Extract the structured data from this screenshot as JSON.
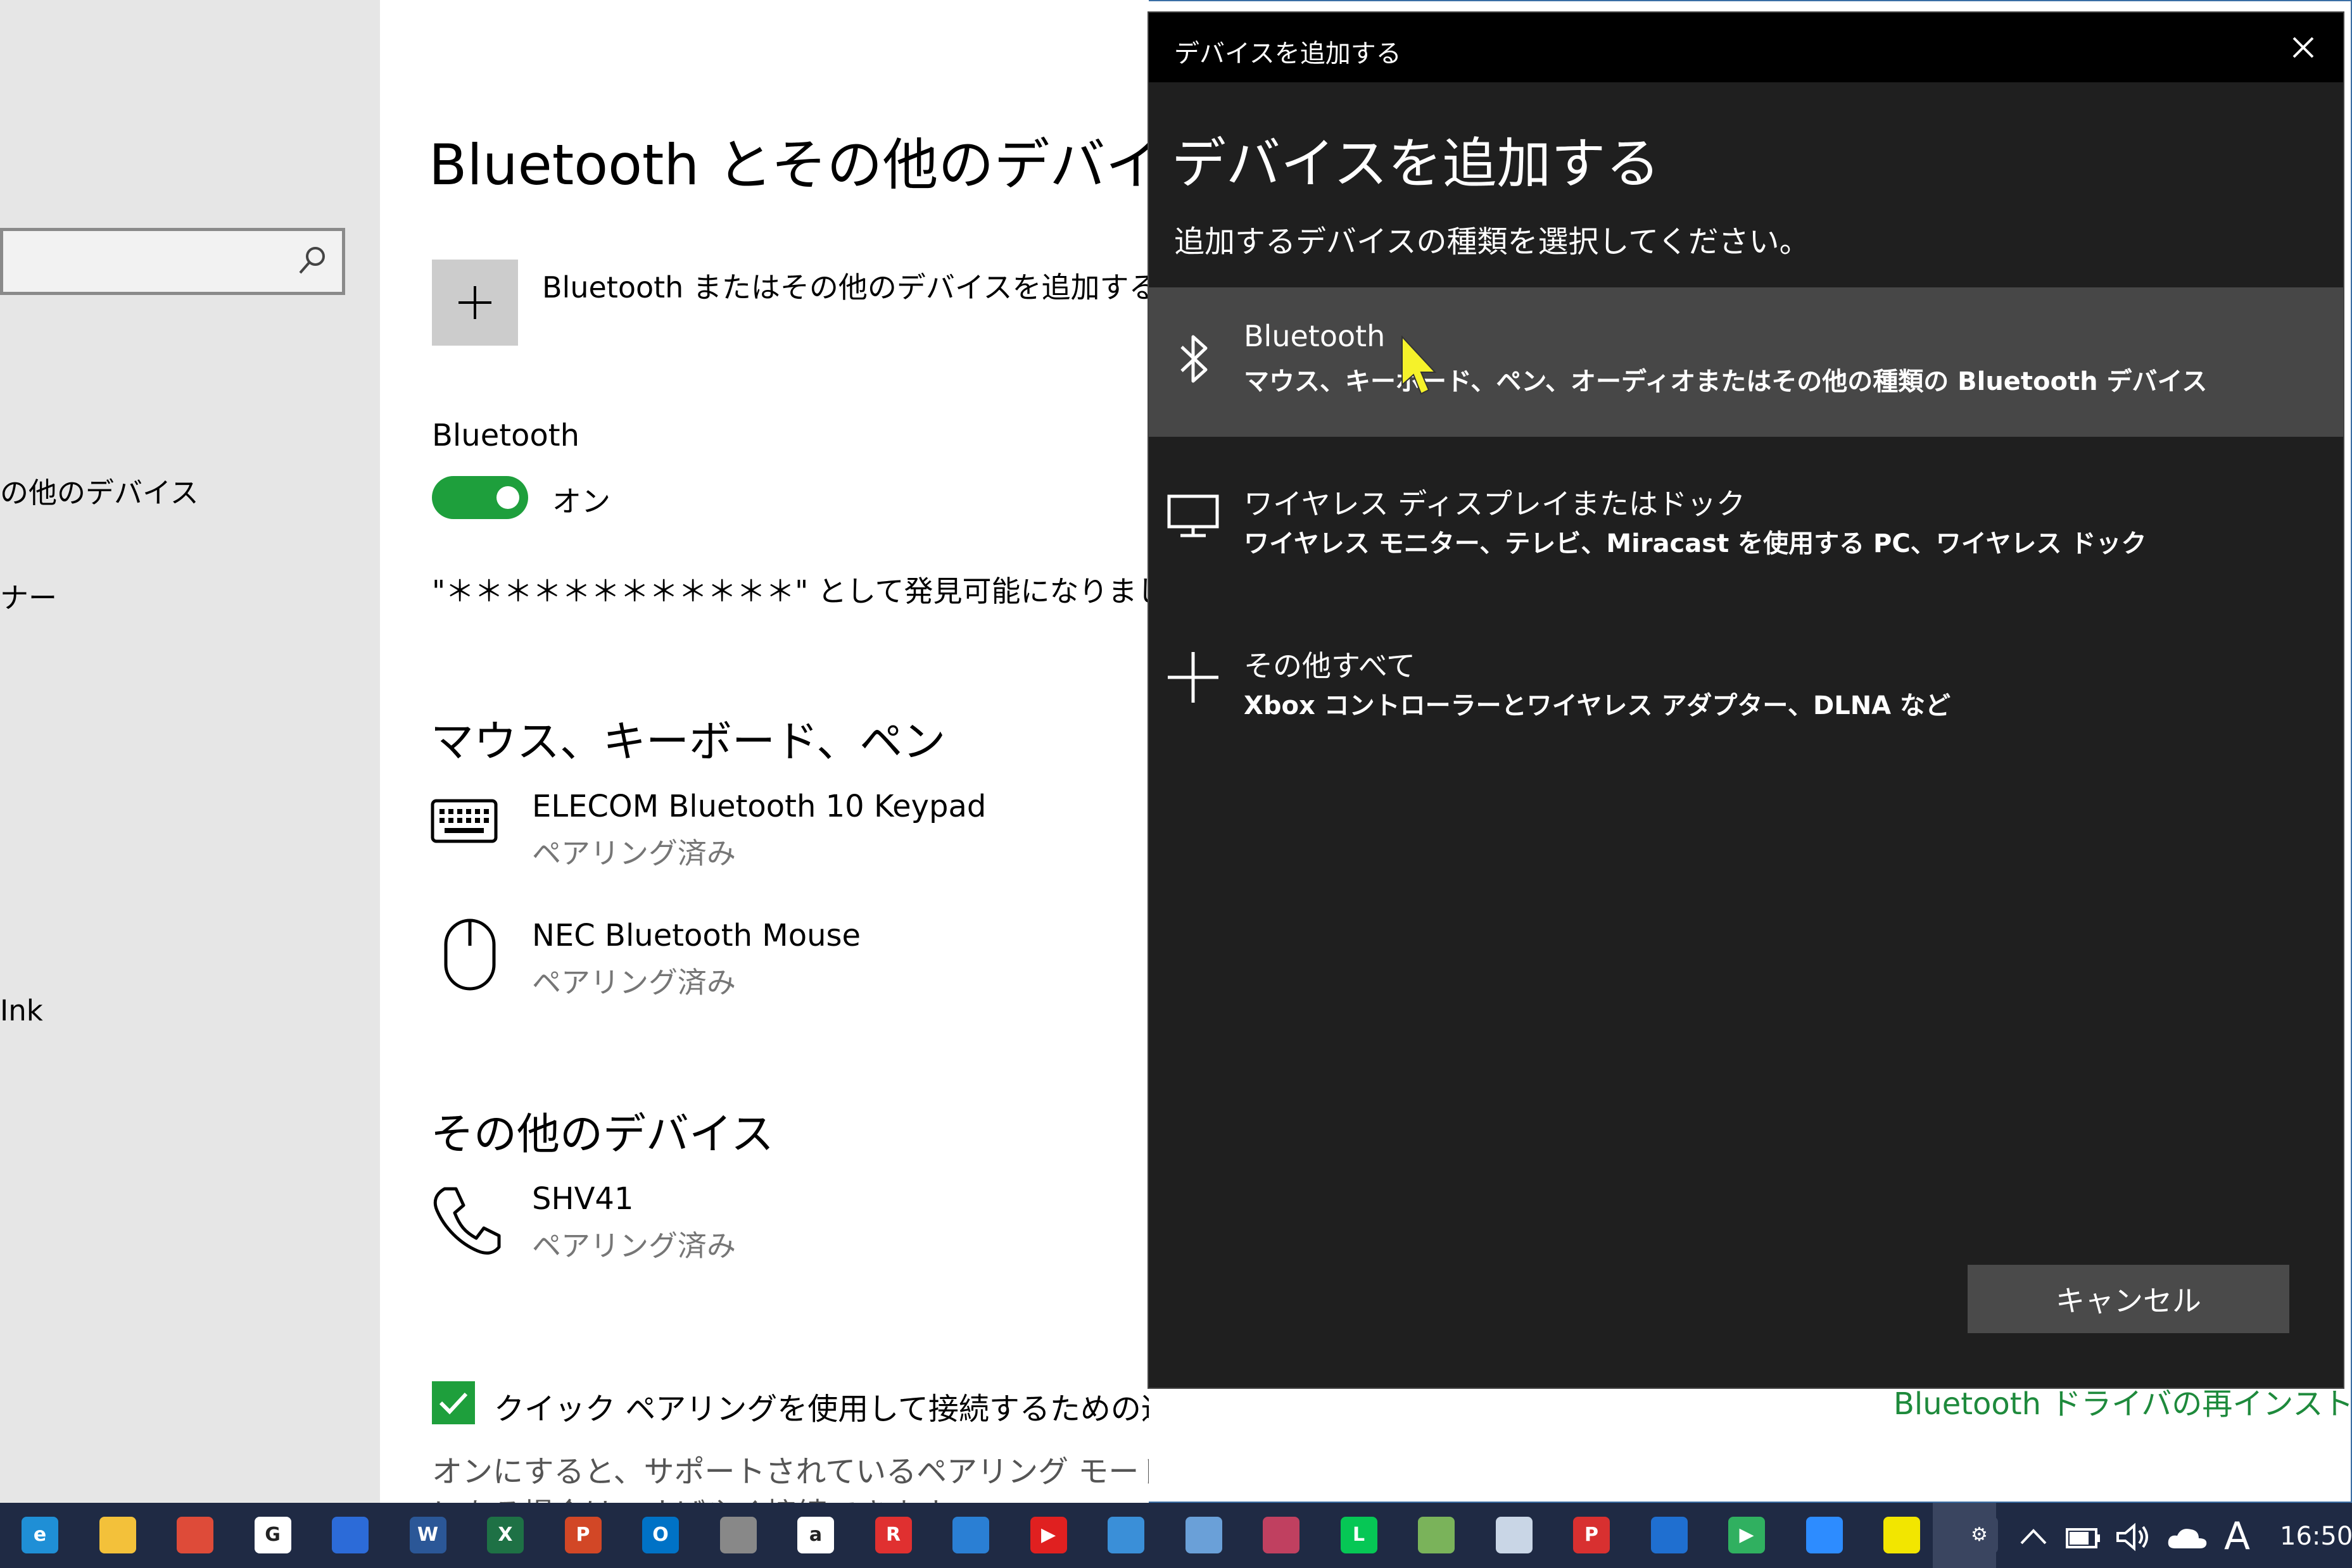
{
  "nav": {
    "items": [
      "の他のデバイス",
      "ナー",
      " Ink"
    ]
  },
  "main": {
    "title": "Bluetooth とその他のデバイス",
    "add_device": "Bluetooth またはその他のデバイスを追加する",
    "bluetooth_label": "Bluetooth",
    "toggle_state": "オン",
    "discoverable": "\"＊＊＊＊＊＊＊＊＊＊＊＊\" として発見可能になりました",
    "section_mouse": "マウス、キーボード、ペン",
    "devices": [
      {
        "name": "ELECOM Bluetooth 10 Keypad",
        "status": "ペアリング済み",
        "icon": "keyboard-icon"
      },
      {
        "name": "NEC Bluetooth Mouse",
        "status": "ペアリング済み",
        "icon": "mouse-icon"
      }
    ],
    "section_other": "その他のデバイス",
    "other_devices": [
      {
        "name": "SHV41",
        "status": "ペアリング済み",
        "icon": "phone-icon"
      }
    ],
    "swift_pair_label": "クイック ペアリングを使用して接続するための通知を表示する",
    "swift_pair_desc1": "オンにすると、サポートされているペアリング モードの Bluetooth デバイスが近く",
    "swift_pair_desc2": "にある場合は、すばやく接続できます。",
    "right_link": "Bluetooth ドライバの再インストール"
  },
  "dialog": {
    "titlebar": "デバイスを追加する",
    "heading": "デバイスを追加する",
    "subtitle": "追加するデバイスの種類を選択してください。",
    "options": [
      {
        "title": "Bluetooth",
        "desc": "マウス、キーボード、ペン、オーディオまたはその他の種類の Bluetooth デバイス",
        "icon": "bluetooth-icon"
      },
      {
        "title": "ワイヤレス ディスプレイまたはドック",
        "desc": "ワイヤレス モニター、テレビ、Miracast を使用する PC、ワイヤレス ドック",
        "icon": "monitor-icon"
      },
      {
        "title": "その他すべて",
        "desc": "Xbox コントローラーとワイヤレス アダプター、DLNA など",
        "icon": "plus-icon"
      }
    ],
    "cancel": "キャンセル"
  },
  "taskbar": {
    "apps": [
      {
        "name": "edge-icon",
        "color": "#1f8fd6",
        "glyph": "e"
      },
      {
        "name": "file-explorer-icon",
        "color": "#f3c13a",
        "glyph": ""
      },
      {
        "name": "chrome-icon",
        "color": "#de4b39",
        "glyph": ""
      },
      {
        "name": "google-icon",
        "color": "#ffffff",
        "glyph": "G"
      },
      {
        "name": "people-icon",
        "color": "#2c6bd8",
        "glyph": ""
      },
      {
        "name": "word-icon",
        "color": "#2b5797",
        "glyph": "W"
      },
      {
        "name": "excel-icon",
        "color": "#1e7145",
        "glyph": "X"
      },
      {
        "name": "powerpoint-icon",
        "color": "#d24726",
        "glyph": "P"
      },
      {
        "name": "outlook-icon",
        "color": "#0072c6",
        "glyph": "O"
      },
      {
        "name": "printer-icon",
        "color": "#888888",
        "glyph": ""
      },
      {
        "name": "amazon-icon",
        "color": "#ffffff",
        "glyph": "a"
      },
      {
        "name": "iris-icon",
        "color": "#e03030",
        "glyph": "R"
      },
      {
        "name": "news-icon",
        "color": "#2a7fd4",
        "glyph": ""
      },
      {
        "name": "youtube-icon",
        "color": "#e02020",
        "glyph": "▶"
      },
      {
        "name": "photos-icon",
        "color": "#3a8fd8",
        "glyph": ""
      },
      {
        "name": "paint-icon",
        "color": "#6aa0d8",
        "glyph": ""
      },
      {
        "name": "snipping-icon",
        "color": "#c04060",
        "glyph": ""
      },
      {
        "name": "line-icon",
        "color": "#06c755",
        "glyph": "L"
      },
      {
        "name": "maps-icon",
        "color": "#7ab35a",
        "glyph": ""
      },
      {
        "name": "scanner-icon",
        "color": "#c9d6e6",
        "glyph": ""
      },
      {
        "name": "pdf-png-icon",
        "color": "#d83030",
        "glyph": "P"
      },
      {
        "name": "onedrive-icon",
        "color": "#1f6fd0",
        "glyph": ""
      },
      {
        "name": "play-store-icon",
        "color": "#30b060",
        "glyph": "▶"
      },
      {
        "name": "zoom-icon",
        "color": "#2d8cff",
        "glyph": ""
      },
      {
        "name": "povo-icon",
        "color": "#f2e600",
        "glyph": ""
      },
      {
        "name": "settings-icon",
        "color": "#3a4560",
        "glyph": "⚙"
      }
    ],
    "tray": {
      "ime": "A",
      "clock": "16:50"
    }
  }
}
